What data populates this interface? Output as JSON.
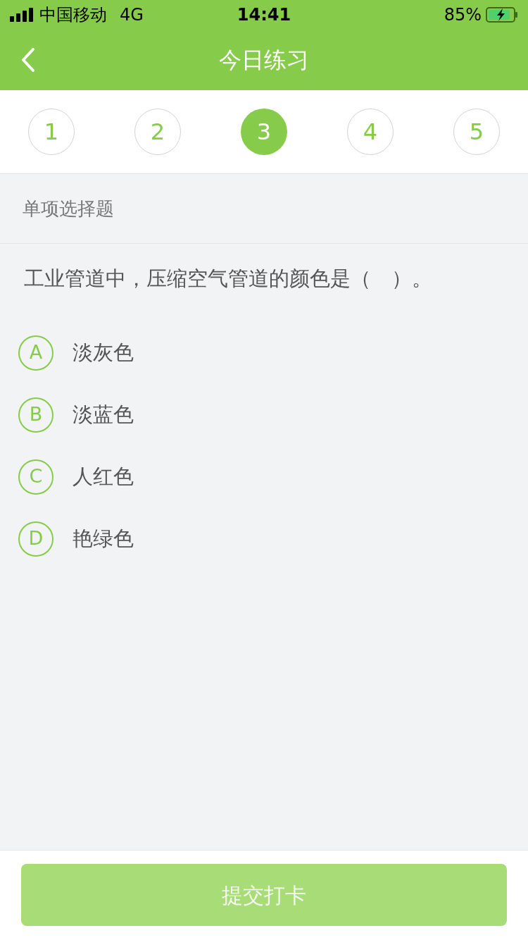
{
  "status_bar": {
    "carrier": "中国移动",
    "network": "4G",
    "time": "14:41",
    "battery": "85%",
    "charging": true
  },
  "header": {
    "title": "今日练习"
  },
  "steps": [
    {
      "label": "1",
      "selected": false
    },
    {
      "label": "2",
      "selected": false
    },
    {
      "label": "3",
      "selected": true
    },
    {
      "label": "4",
      "selected": false
    },
    {
      "label": "5",
      "selected": false
    }
  ],
  "question": {
    "type": "单项选择题",
    "text": "工业管道中，压缩空气管道的颜色是（　）。",
    "options": [
      {
        "letter": "A",
        "text": "淡灰色",
        "selected": false
      },
      {
        "letter": "B",
        "text": "淡蓝色",
        "selected": false
      },
      {
        "letter": "C",
        "text": "人红色",
        "selected": false
      },
      {
        "letter": "D",
        "text": "艳绿色",
        "selected": false
      }
    ]
  },
  "submit": {
    "label": "提交打卡",
    "disabled": true
  }
}
